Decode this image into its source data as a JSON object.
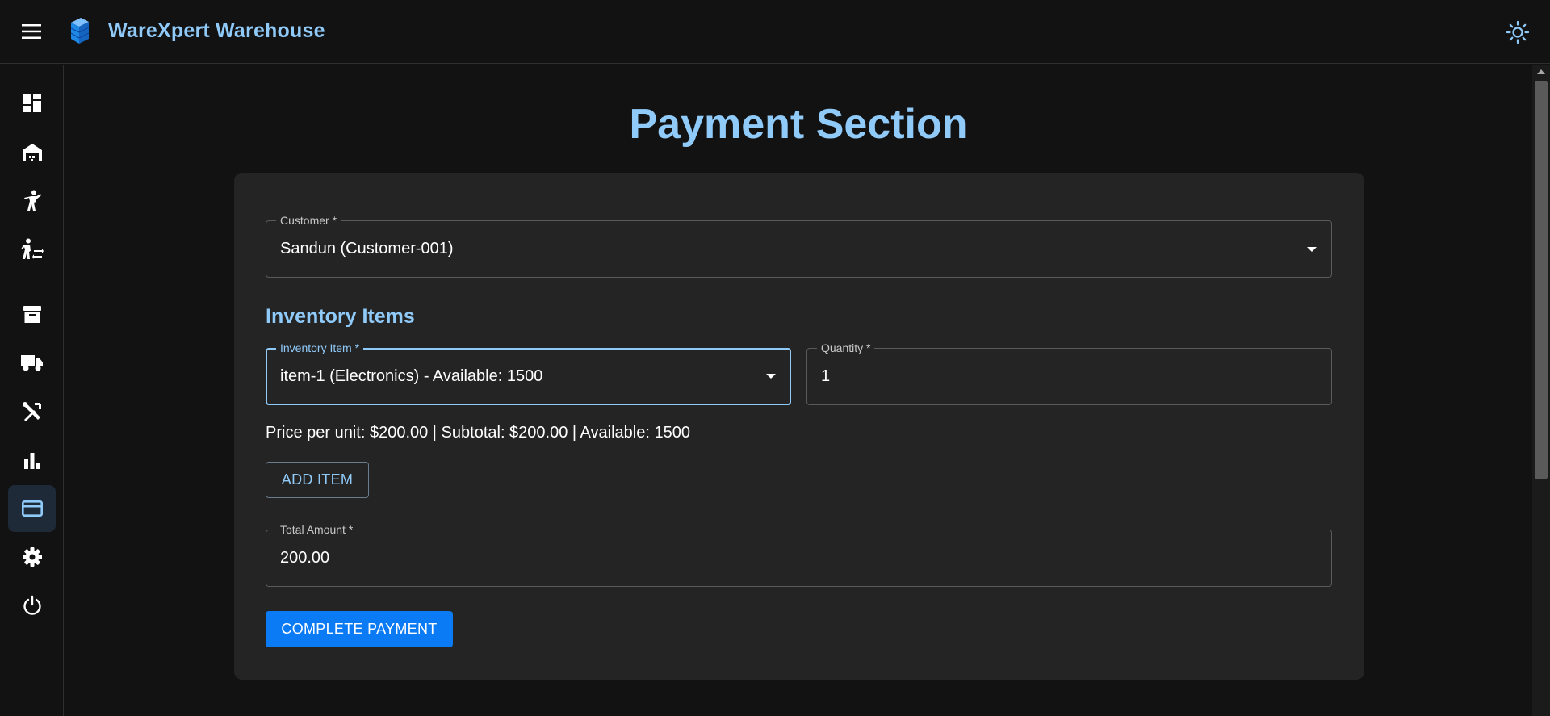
{
  "app": {
    "title": "WareXpert Warehouse",
    "accent": "#90caf9",
    "primary_button_color": "#0b7bf5"
  },
  "topbar": {
    "menu_icon": "hamburger-menu-icon",
    "logo_icon": "stacked-blocks-logo-icon",
    "theme_icon": "sun-icon"
  },
  "sidebar": {
    "items": [
      {
        "id": "dashboard",
        "icon": "dashboard-icon",
        "active": false
      },
      {
        "id": "warehouse",
        "icon": "warehouse-icon",
        "active": false
      },
      {
        "id": "staff",
        "icon": "person-walking-icon",
        "active": false
      },
      {
        "id": "transfers",
        "icon": "person-transfer-icon",
        "active": false
      },
      {
        "id": "inventory",
        "icon": "archive-box-icon",
        "active": false
      },
      {
        "id": "delivery",
        "icon": "truck-icon",
        "active": false
      },
      {
        "id": "maintenance",
        "icon": "tools-icon",
        "active": false
      },
      {
        "id": "reports",
        "icon": "bar-chart-icon",
        "active": false
      },
      {
        "id": "payments",
        "icon": "credit-card-icon",
        "active": true
      },
      {
        "id": "settings",
        "icon": "gear-icon",
        "active": false
      },
      {
        "id": "logout",
        "icon": "power-icon",
        "active": false
      }
    ]
  },
  "page": {
    "title": "Payment Section"
  },
  "form": {
    "customer": {
      "label": "Customer *",
      "value": "Sandun (Customer-001)"
    },
    "inventory_heading": "Inventory Items",
    "inventory_item": {
      "label": "Inventory Item *",
      "value": "item-1 (Electronics) - Available: 1500"
    },
    "quantity": {
      "label": "Quantity *",
      "value": "1"
    },
    "price_line": "Price per unit: $200.00 | Subtotal: $200.00 | Available: 1500",
    "add_item_label": "ADD ITEM",
    "total_amount": {
      "label": "Total Amount *",
      "value": "200.00"
    },
    "complete_payment_label": "COMPLETE PAYMENT"
  }
}
